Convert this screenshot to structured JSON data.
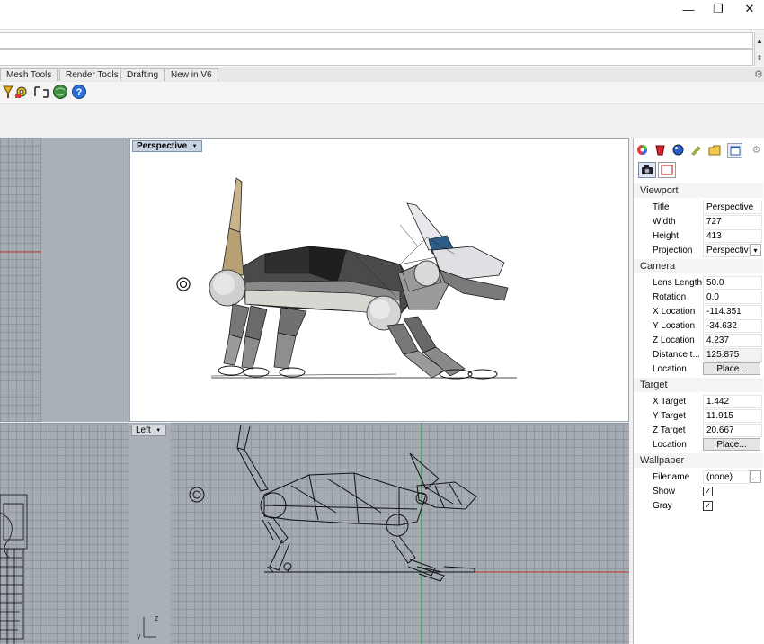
{
  "window": {
    "minimize_glyph": "—",
    "restore_glyph": "❐",
    "close_glyph": "✕"
  },
  "tabs": [
    {
      "label": "Mesh Tools"
    },
    {
      "label": "Render Tools"
    },
    {
      "label": "Drafting"
    },
    {
      "label": "New in V6"
    }
  ],
  "toolbar": {
    "icons": [
      "select-filter-icon",
      "gear-options-icon",
      "bracket-tool-icon",
      "render-globe-icon",
      "help-icon"
    ]
  },
  "viewports": {
    "perspective": {
      "label": "Perspective"
    },
    "left": {
      "label": "Left"
    },
    "axis_z": "z",
    "axis_y": "y"
  },
  "panel": {
    "sections": {
      "viewport": "Viewport",
      "camera": "Camera",
      "target": "Target",
      "wallpaper": "Wallpaper"
    },
    "viewport_rows": [
      {
        "label": "Title",
        "value": "Perspective"
      },
      {
        "label": "Width",
        "value": "727"
      },
      {
        "label": "Height",
        "value": "413"
      },
      {
        "label": "Projection",
        "value": "Perspective"
      }
    ],
    "camera_rows": [
      {
        "label": "Lens Length",
        "value": "50.0"
      },
      {
        "label": "Rotation",
        "value": "0.0"
      },
      {
        "label": "X Location",
        "value": "-114.351"
      },
      {
        "label": "Y Location",
        "value": "-34.632"
      },
      {
        "label": "Z Location",
        "value": "4.237"
      },
      {
        "label": "Distance t...",
        "value": "125.875"
      },
      {
        "label": "Location",
        "value": "Place..."
      }
    ],
    "target_rows": [
      {
        "label": "X Target",
        "value": "1.442"
      },
      {
        "label": "Y Target",
        "value": "11.915"
      },
      {
        "label": "Z Target",
        "value": "20.667"
      },
      {
        "label": "Location",
        "value": "Place..."
      }
    ],
    "wallpaper_rows": [
      {
        "label": "Filename",
        "value": "(none)"
      },
      {
        "label": "Show",
        "checked": true
      },
      {
        "label": "Gray",
        "checked": true
      }
    ],
    "browse_label": "...",
    "dropdown_glyph": "▾",
    "check_glyph": "✓"
  },
  "colors": {
    "viewport_grid": "#a4abb3",
    "active_label": "#c8d4e3",
    "x_axis": "#c0392b",
    "y_axis": "#2ea043"
  }
}
